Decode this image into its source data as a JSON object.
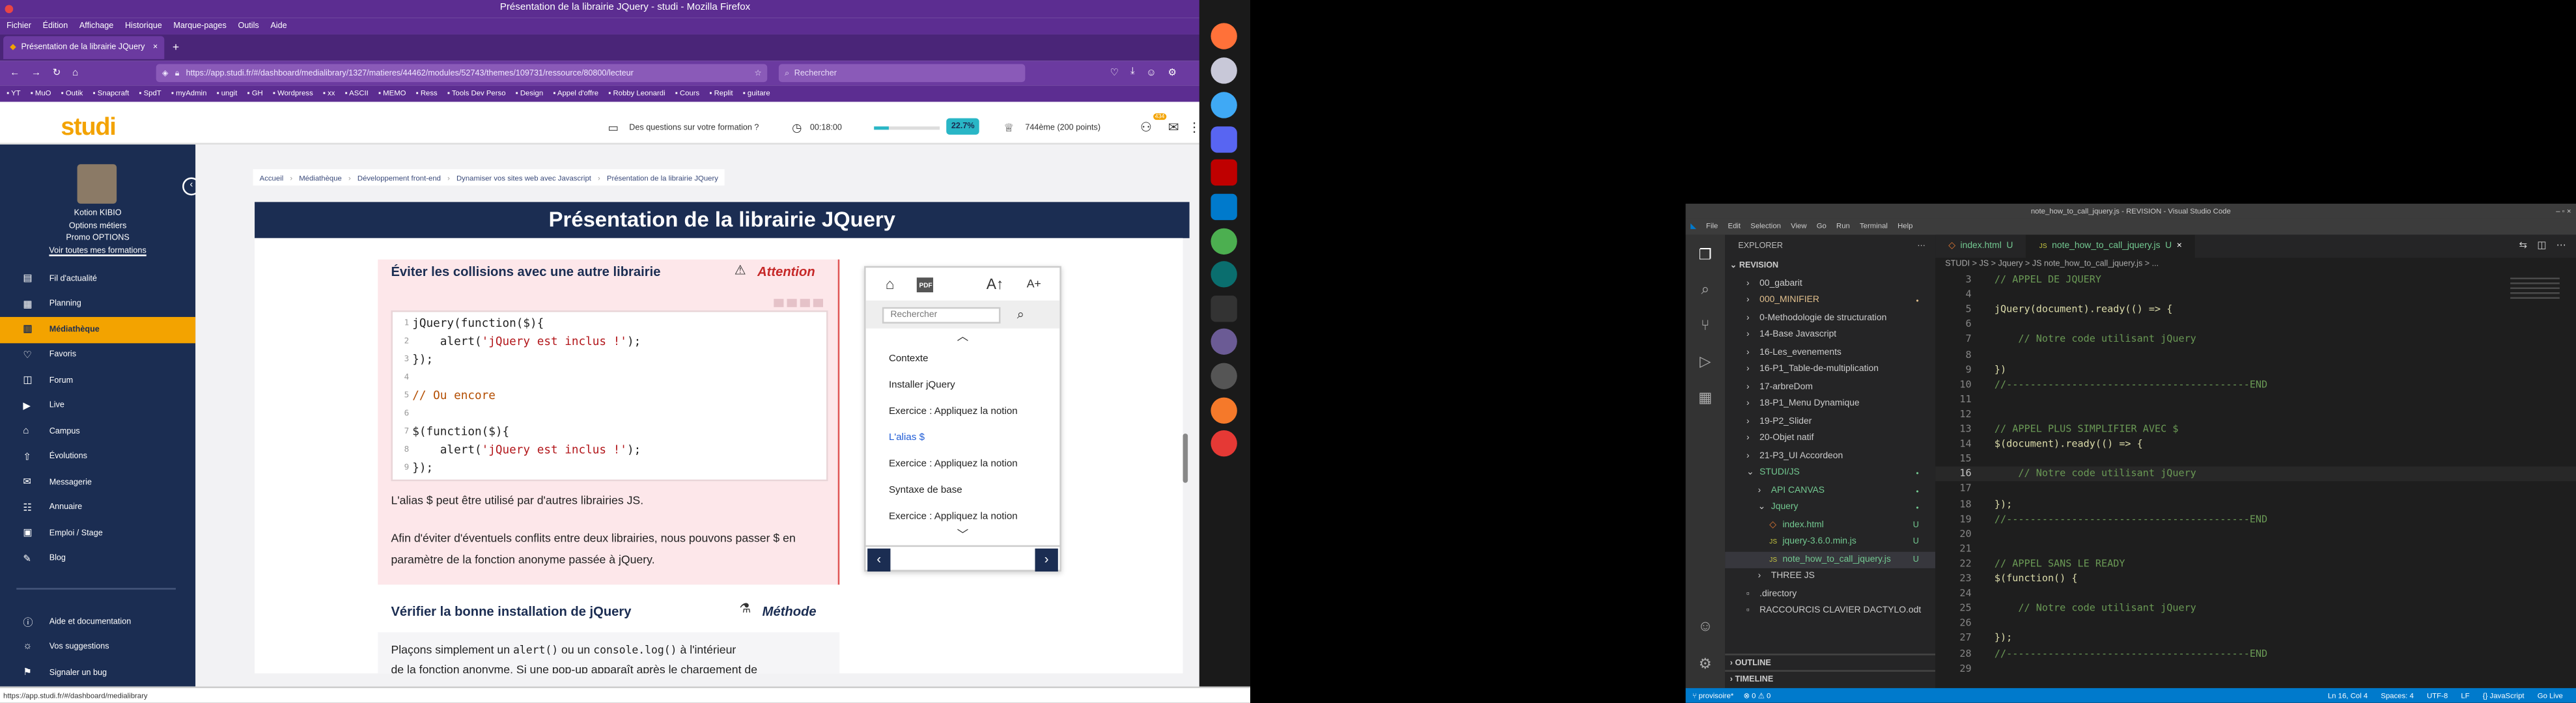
{
  "firefox": {
    "window_title": "Présentation de la librairie JQuery - studi - Mozilla Firefox",
    "menu": [
      "Fichier",
      "Édition",
      "Affichage",
      "Historique",
      "Marque-pages",
      "Outils",
      "Aide"
    ],
    "tab_title": "Présentation de la librairie JQuery",
    "url": "https://app.studi.fr/#/dashboard/medialibrary/1327/matieres/44462/modules/52743/themes/109731/ressource/80800/lecteur",
    "search_placeholder": "Rechercher",
    "bookmarks": [
      "YT",
      "MuO",
      "Outik",
      "Snapcraft",
      "SpdT",
      "myAdmin",
      "ungit",
      "GH",
      "Wordpress",
      "xx",
      "ASCII",
      "MEMO",
      "Ress",
      "Tools Dev Perso",
      "Design",
      "Appel d'offre",
      "Robby Leonardi",
      "Cours",
      "Replit",
      "guitare"
    ],
    "status_url": "https://app.studi.fr/#/dashboard/medialibrary"
  },
  "studi": {
    "logo": "studi",
    "question_link": "Des questions sur votre formation ?",
    "timer": "00:18:00",
    "progress_label": "22.7%",
    "progress": 0.227,
    "rank": "744ème (200 points)",
    "badge": "434",
    "user": {
      "name": "Kotion KIBIO",
      "line1": "Options métiers",
      "line2": "Promo OPTIONS",
      "formations_link": "Voir toutes mes formations"
    },
    "nav": [
      "Fil d'actualité",
      "Planning",
      "Médiathèque",
      "Favoris",
      "Forum",
      "Live",
      "Campus",
      "Évolutions",
      "Messagerie",
      "Annuaire",
      "Emploi / Stage",
      "Blog"
    ],
    "nav_bottom": [
      "Aide et documentation",
      "Vos suggestions",
      "Signaler un bug"
    ],
    "breadcrumb": [
      "Accueil",
      "Médiathèque",
      "Développement front-end",
      "Dynamiser vos sites web avec Javascript",
      "Présentation de la librairie JQuery"
    ],
    "lesson_title": "Présentation de la librairie JQuery",
    "section1_title": "Éviter les collisions avec une autre librairie",
    "attention_label": "Attention",
    "code_lines": [
      {
        "n": "1",
        "parts": [
          [
            "jQuery(function($){",
            ""
          ]
        ]
      },
      {
        "n": "2",
        "parts": [
          [
            "    alert(",
            ""
          ],
          [
            "'jQuery est inclus !'",
            "str"
          ],
          [
            ");",
            ""
          ]
        ]
      },
      {
        "n": "3",
        "parts": [
          [
            "});",
            ""
          ]
        ]
      },
      {
        "n": "4",
        "parts": [
          [
            "",
            ""
          ]
        ]
      },
      {
        "n": "5",
        "parts": [
          [
            "// Ou encore",
            "cmt"
          ]
        ]
      },
      {
        "n": "6",
        "parts": [
          [
            "",
            ""
          ]
        ]
      },
      {
        "n": "7",
        "parts": [
          [
            "$(function($){",
            ""
          ]
        ]
      },
      {
        "n": "8",
        "parts": [
          [
            "    alert(",
            ""
          ],
          [
            "'jQuery est inclus !'",
            "str"
          ],
          [
            ");",
            ""
          ]
        ]
      },
      {
        "n": "9",
        "parts": [
          [
            "});",
            ""
          ]
        ]
      }
    ],
    "para1": "L'alias $ peut être utilisé par d'autres librairies JS.",
    "para2": "Afin d'éviter d'éventuels conflits entre deux librairies, nous pouvons passer $ en paramètre de la fonction anonyme passée à jQuery.",
    "section2_title": "Vérifier la bonne installation de jQuery",
    "methode_label": "Méthode",
    "para3_a": "Plaçons simplement un ",
    "para3_code1": "alert()",
    "para3_b": " ou un ",
    "para3_code2": "console.log()",
    "para3_c": " à l'intérieur",
    "para3_line2": "de la fonction anonyme. Si une pop-up apparaît après le chargement de",
    "toc_search": "Rechercher",
    "toc_pdf": "PDF",
    "toc_items": [
      "Contexte",
      "Installer jQuery",
      "Exercice : Appliquez la notion",
      "L'alias $",
      "Exercice : Appliquez la notion",
      "Syntaxe de base",
      "Exercice : Appliquez la notion"
    ],
    "toc_active": 3
  },
  "vscode": {
    "title": "note_how_to_call_jquery.js - REVISION - Visual Studio Code",
    "menu": [
      "File",
      "Edit",
      "Selection",
      "View",
      "Go",
      "Run",
      "Terminal",
      "Help"
    ],
    "explorer_label": "EXPLORER",
    "root": "REVISION",
    "tree": [
      {
        "label": "00_gabarit",
        "depth": 1,
        "kind": "folder",
        "badge": ""
      },
      {
        "label": "000_MINIFIER",
        "depth": 1,
        "kind": "folder",
        "badge": "dot",
        "color": "#e2c08d"
      },
      {
        "label": "0-Methodologie de structuration",
        "depth": 1,
        "kind": "folder",
        "badge": ""
      },
      {
        "label": "14-Base Javascript",
        "depth": 1,
        "kind": "folder",
        "badge": ""
      },
      {
        "label": "16-Les_evenements",
        "depth": 1,
        "kind": "folder",
        "badge": ""
      },
      {
        "label": "16-P1_Table-de-multiplication",
        "depth": 1,
        "kind": "folder",
        "badge": ""
      },
      {
        "label": "17-arbreDom",
        "depth": 1,
        "kind": "folder",
        "badge": ""
      },
      {
        "label": "18-P1_Menu Dynamique",
        "depth": 1,
        "kind": "folder",
        "badge": ""
      },
      {
        "label": "19-P2_Slider",
        "depth": 1,
        "kind": "folder",
        "badge": ""
      },
      {
        "label": "20-Objet natif",
        "depth": 1,
        "kind": "folder",
        "badge": ""
      },
      {
        "label": "21-P3_UI Accordeon",
        "depth": 1,
        "kind": "folder",
        "badge": ""
      },
      {
        "label": "STUDI/JS",
        "depth": 1,
        "kind": "open",
        "badge": "dot",
        "color": "#73c991"
      },
      {
        "label": "API CANVAS",
        "depth": 2,
        "kind": "folder",
        "badge": "dot",
        "color": "#73c991"
      },
      {
        "label": "Jquery",
        "depth": 2,
        "kind": "open",
        "badge": "dot",
        "color": "#73c991"
      },
      {
        "label": "index.html",
        "depth": 3,
        "kind": "html",
        "badge": "U",
        "color": "#73c991"
      },
      {
        "label": "jquery-3.6.0.min.js",
        "depth": 3,
        "kind": "js",
        "badge": "U",
        "color": "#73c991"
      },
      {
        "label": "note_how_to_call_jquery.js",
        "depth": 3,
        "kind": "js",
        "badge": "U",
        "color": "#73c991",
        "selected": true
      },
      {
        "label": "THREE JS",
        "depth": 2,
        "kind": "folder",
        "badge": ""
      },
      {
        "label": ".directory",
        "depth": 1,
        "kind": "file",
        "badge": ""
      },
      {
        "label": "RACCOURCIS CLAVIER DACTYLO.odt",
        "depth": 1,
        "kind": "file",
        "badge": ""
      }
    ],
    "outline": "OUTLINE",
    "timeline": "TIMELINE",
    "tabs": [
      {
        "label": "index.html",
        "badge": "U"
      },
      {
        "label": "note_how_to_call_jquery.js",
        "badge": "U"
      }
    ],
    "breadcrumb": "STUDI > JS > Jquery > JS note_how_to_call_jquery.js > ...",
    "code": [
      {
        "n": "3",
        "t": "// APPEL DE JQUERY",
        "c": "cmt"
      },
      {
        "n": "4",
        "t": "",
        "c": ""
      },
      {
        "n": "5",
        "t": "jQuery(document).ready(() => {",
        "c": "code"
      },
      {
        "n": "6",
        "t": "",
        "c": ""
      },
      {
        "n": "7",
        "t": "    // Notre code utilisant jQuery",
        "c": "cmt"
      },
      {
        "n": "8",
        "t": "",
        "c": ""
      },
      {
        "n": "9",
        "t": "})",
        "c": "code"
      },
      {
        "n": "10",
        "t": "//-----------------------------------------END",
        "c": "cmt"
      },
      {
        "n": "11",
        "t": "",
        "c": ""
      },
      {
        "n": "12",
        "t": "",
        "c": ""
      },
      {
        "n": "13",
        "t": "// APPEL PLUS SIMPLIFIER AVEC $",
        "c": "cmt"
      },
      {
        "n": "14",
        "t": "$(document).ready(() => {",
        "c": "code"
      },
      {
        "n": "15",
        "t": "",
        "c": ""
      },
      {
        "n": "16",
        "t": "    // Notre code utilisant jQuery",
        "c": "cmt"
      },
      {
        "n": "17",
        "t": "",
        "c": ""
      },
      {
        "n": "18",
        "t": "});",
        "c": "code"
      },
      {
        "n": "19",
        "t": "//-----------------------------------------END",
        "c": "cmt"
      },
      {
        "n": "20",
        "t": "",
        "c": ""
      },
      {
        "n": "21",
        "t": "",
        "c": ""
      },
      {
        "n": "22",
        "t": "// APPEL SANS LE READY",
        "c": "cmt"
      },
      {
        "n": "23",
        "t": "$(function() {",
        "c": "code"
      },
      {
        "n": "24",
        "t": "",
        "c": ""
      },
      {
        "n": "25",
        "t": "    // Notre code utilisant jQuery",
        "c": "cmt"
      },
      {
        "n": "26",
        "t": "",
        "c": ""
      },
      {
        "n": "27",
        "t": "});",
        "c": "code"
      },
      {
        "n": "28",
        "t": "//-----------------------------------------END",
        "c": "cmt"
      },
      {
        "n": "29",
        "t": "",
        "c": ""
      }
    ],
    "status_left": "provisoire*",
    "status_errors": "0 ⚠ 0",
    "status_items": [
      "Ln 16, Col 4",
      "Spaces: 4",
      "UTF-8",
      "LF",
      "{} JavaScript",
      "Go Live"
    ],
    "accent": "#007acc"
  }
}
